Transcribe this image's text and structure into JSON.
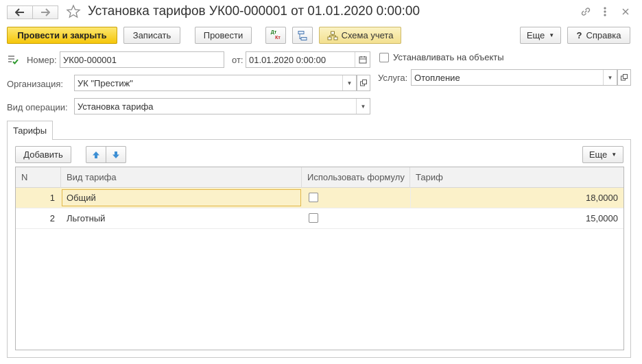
{
  "header": {
    "title": "Установка тарифов УК00-000001 от 01.01.2020 0:00:00"
  },
  "toolbar": {
    "post_close": "Провести и закрыть",
    "save": "Записать",
    "post": "Провести",
    "dt_kt_top": "Дт",
    "dt_kt_bottom": "Кт",
    "accounting_scheme": "Схема учета",
    "more": "Еще",
    "help": "Справка",
    "help_symbol": "?"
  },
  "form": {
    "number_label": "Номер:",
    "number_value": "УК00-000001",
    "date_label": "от:",
    "date_value": "01.01.2020  0:00:00",
    "set_on_objects_label": "Устанавливать на объекты",
    "org_label": "Организация:",
    "org_value": "УК \"Престиж\"",
    "service_label": "Услуга:",
    "service_value": "Отопление",
    "op_type_label": "Вид операции:",
    "op_type_value": "Установка тарифа"
  },
  "tabs": [
    {
      "label": "Тарифы"
    }
  ],
  "table_toolbar": {
    "add": "Добавить",
    "more": "Еще"
  },
  "table": {
    "columns": [
      "N",
      "Вид тарифа",
      "Использовать формулу",
      "Тариф"
    ],
    "rows": [
      {
        "n": "1",
        "type": "Общий",
        "use_formula": false,
        "tariff": "18,0000"
      },
      {
        "n": "2",
        "type": "Льготный",
        "use_formula": false,
        "tariff": "15,0000"
      }
    ]
  },
  "colors": {
    "primary": "#f5c60a",
    "selected_row": "#fbf1c9",
    "arrow_blue": "#3d8fd4"
  }
}
